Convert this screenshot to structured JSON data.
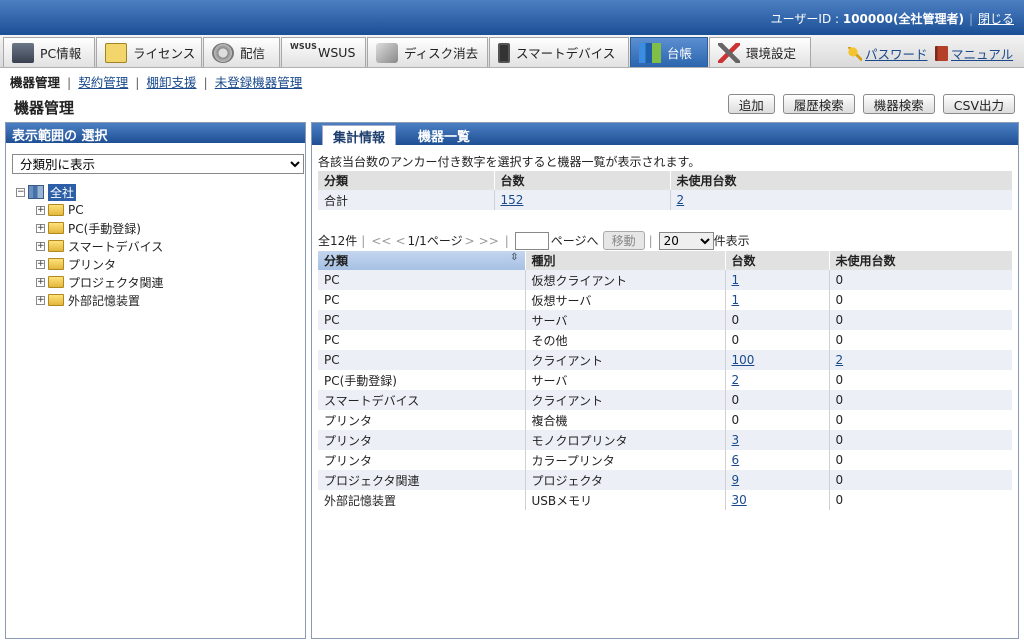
{
  "header": {
    "user_label": "ユーザーID : ",
    "user_id": "100000(全社管理者)",
    "close": "閉じる"
  },
  "tabs": [
    {
      "label": "PC情報",
      "icon": "pc-icon"
    },
    {
      "label": "ライセンス",
      "icon": "license-icon"
    },
    {
      "label": "配信",
      "icon": "distribution-icon"
    },
    {
      "label": "WSUS",
      "icon": "wsus-icon"
    },
    {
      "label": "ディスク消去",
      "icon": "disk-erase-icon"
    },
    {
      "label": "スマートデバイス",
      "icon": "smart-device-icon"
    },
    {
      "label": "台帳",
      "icon": "ledger-icon",
      "active": true
    },
    {
      "label": "環境設定",
      "icon": "settings-icon"
    }
  ],
  "top_links": {
    "password": "パスワード",
    "manual": "マニュアル"
  },
  "subnav": {
    "current": "機器管理",
    "items": [
      "契約管理",
      "棚卸支援",
      "未登録機器管理"
    ]
  },
  "page_title": "機器管理",
  "actions": {
    "add": "追加",
    "history": "履歴検索",
    "device_search": "機器検索",
    "csv": "CSV出力"
  },
  "left_panel": {
    "title": "表示範囲の 選択",
    "view_select": "分類別に表示",
    "tree": {
      "root": "全社",
      "children": [
        "PC",
        "PC(手動登録)",
        "スマートデバイス",
        "プリンタ",
        "プロジェクタ関連",
        "外部記憶装置"
      ]
    }
  },
  "right_panel": {
    "tabs": {
      "summary": "集計情報",
      "list": "機器一覧"
    },
    "description": "各該当台数のアンカー付き数字を選択すると機器一覧が表示されます。",
    "summary_table": {
      "headers": [
        "分類",
        "台数",
        "未使用台数"
      ],
      "row": [
        "合計",
        "152",
        "2"
      ]
    },
    "pager": {
      "total": "全12件",
      "page_info": "1/1ページ",
      "goto_label": "ページへ",
      "move_button": "移動",
      "per_page": "20",
      "per_page_suffix": "件表示"
    },
    "detail_table": {
      "headers": [
        "分類",
        "種別",
        "台数",
        "未使用台数"
      ],
      "rows": [
        [
          "PC",
          "仮想クライアント",
          "1",
          "0"
        ],
        [
          "PC",
          "仮想サーバ",
          "1",
          "0"
        ],
        [
          "PC",
          "サーバ",
          "0",
          "0"
        ],
        [
          "PC",
          "その他",
          "0",
          "0"
        ],
        [
          "PC",
          "クライアント",
          "100",
          "2"
        ],
        [
          "PC(手動登録)",
          "サーバ",
          "2",
          "0"
        ],
        [
          "スマートデバイス",
          "クライアント",
          "0",
          "0"
        ],
        [
          "プリンタ",
          "複合機",
          "0",
          "0"
        ],
        [
          "プリンタ",
          "モノクロプリンタ",
          "3",
          "0"
        ],
        [
          "プリンタ",
          "カラープリンタ",
          "6",
          "0"
        ],
        [
          "プロジェクタ関連",
          "プロジェクタ",
          "9",
          "0"
        ],
        [
          "外部記憶装置",
          "USBメモリ",
          "30",
          "0"
        ]
      ]
    }
  }
}
